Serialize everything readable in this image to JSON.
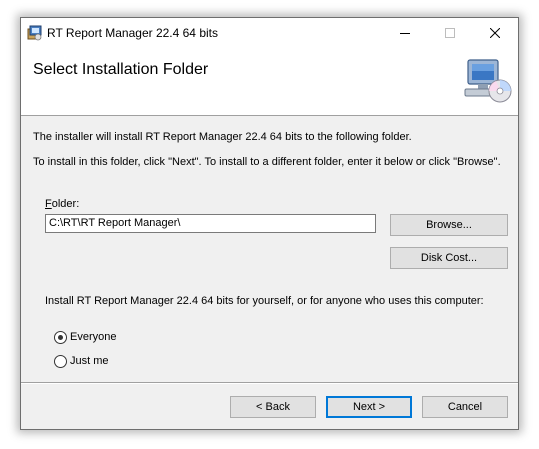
{
  "window": {
    "title": "RT Report Manager 22.4 64 bits",
    "controls": [
      "minimize",
      "maximize",
      "close"
    ]
  },
  "header": {
    "title": "Select Installation Folder",
    "icon": "computer-cd-icon"
  },
  "body": {
    "line1": "The installer will install RT Report Manager 22.4 64 bits to the following folder.",
    "line2": "To install in this folder, click \"Next\". To install to a different folder, enter it below or click \"Browse\".",
    "folder_label_accel": "F",
    "folder_label_rest": "older:",
    "folder_value": "C:\\RT\\RT Report Manager\\",
    "browse_label": "Browse...",
    "disk_cost_label": "Disk Cost...",
    "prompt": "Install RT Report Manager 22.4 64 bits for yourself, or for anyone who uses this computer:",
    "options": [
      {
        "label": "Everyone",
        "selected": true
      },
      {
        "label": "Just me",
        "selected": false
      }
    ]
  },
  "footer": {
    "back_label": "< Back",
    "next_label": "Next >",
    "cancel_label": "Cancel"
  },
  "colors": {
    "dialog_bg": "#f0f0f0",
    "default_button_border": "#0078d7"
  }
}
